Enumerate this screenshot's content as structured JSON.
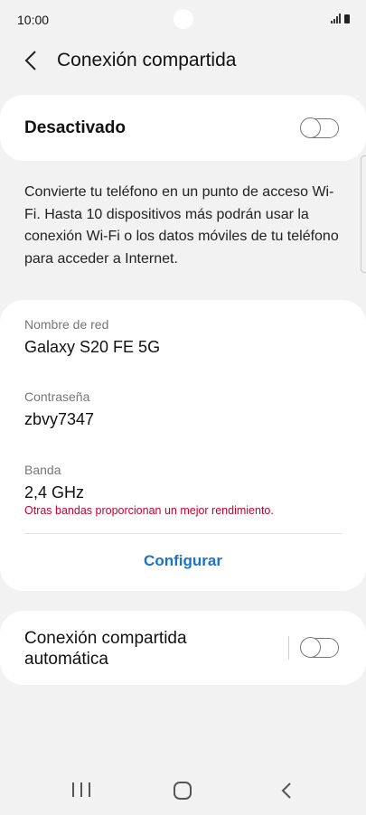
{
  "status_bar": {
    "time": "10:00",
    "icons": [
      "signal-icon",
      "battery-icon"
    ]
  },
  "header": {
    "back_icon": "chevron-left-icon",
    "title": "Conexión compartida"
  },
  "main_toggle": {
    "label": "Desactivado",
    "enabled": false
  },
  "description": "Convierte tu teléfono en un punto de acceso Wi-Fi. Hasta 10 dispositivos más podrán usar la conexión Wi-Fi o los datos móviles de tu teléfono para acceder a Internet.",
  "network": {
    "name_label": "Nombre de red",
    "name_value": "Galaxy S20 FE 5G",
    "password_label": "Contraseña",
    "password_value": "zbvy7347",
    "band_label": "Banda",
    "band_value": "2,4 GHz",
    "band_warning": "Otras bandas proporcionan un mejor rendimiento.",
    "configure_label": "Configurar"
  },
  "auto_hotspot": {
    "label": "Conexión compartida automática",
    "enabled": false
  },
  "nav_bar": {
    "icons": [
      "recents-icon",
      "home-icon",
      "back-icon"
    ]
  },
  "colors": {
    "background": "#f2f2f2",
    "card": "#ffffff",
    "accent": "#1a73c7",
    "warning": "#c4002b"
  }
}
